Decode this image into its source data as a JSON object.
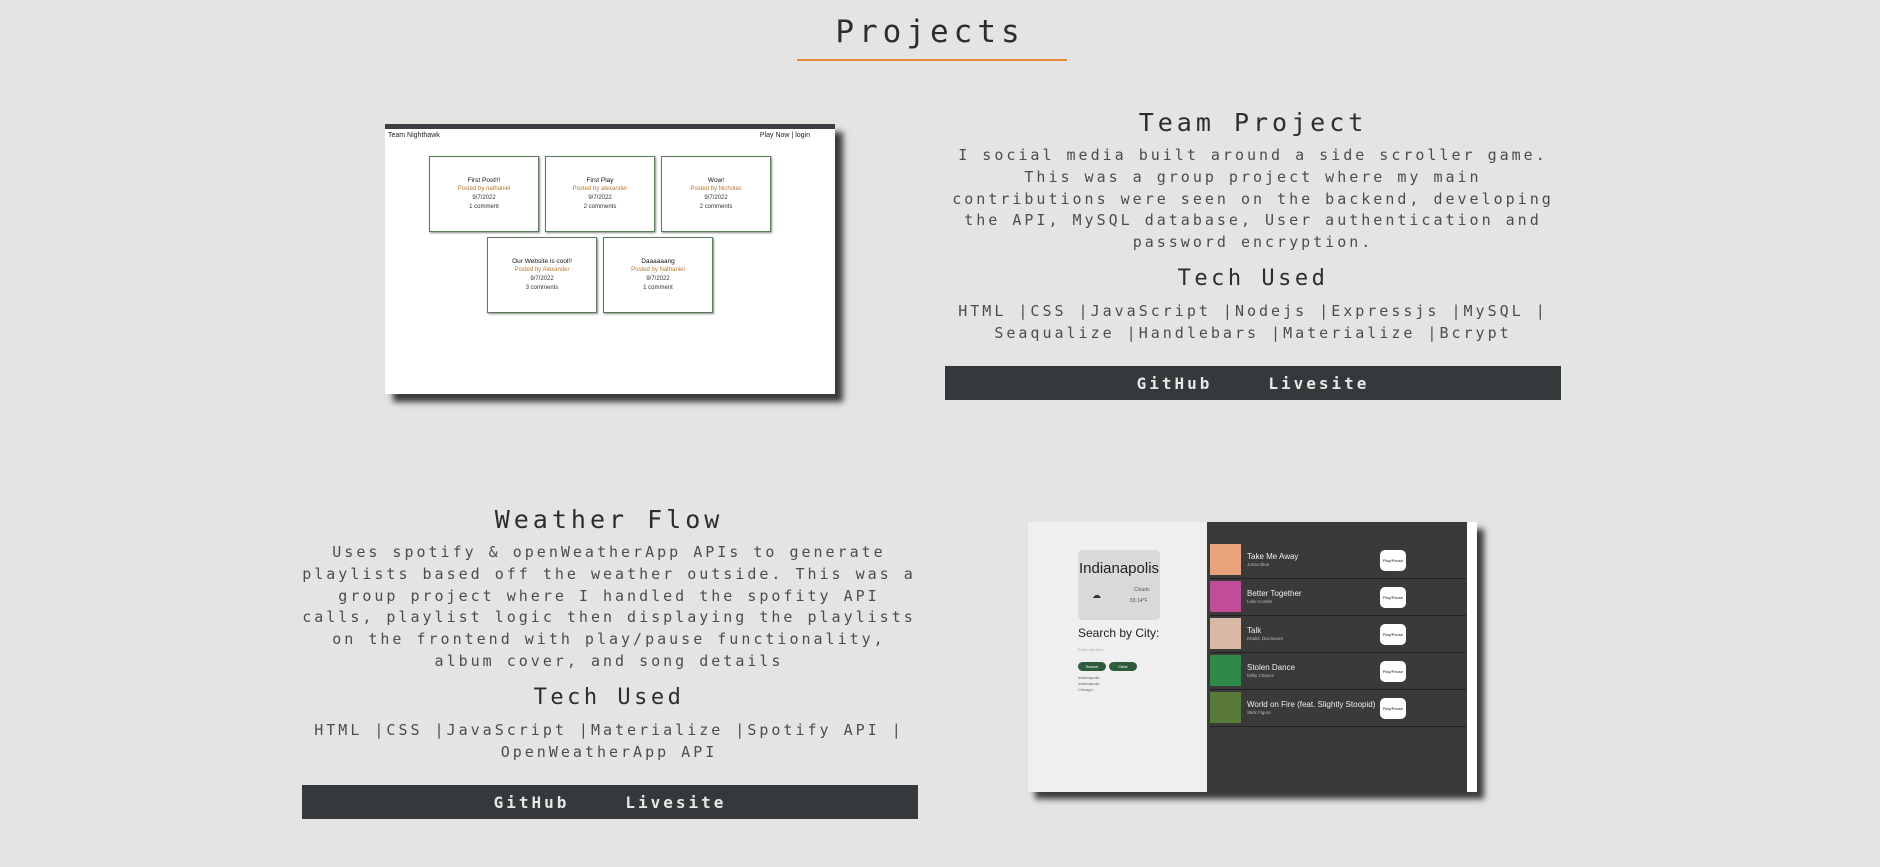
{
  "page": {
    "title": "Projects",
    "accent": "#e38b3a"
  },
  "projects": [
    {
      "name": "Team Project",
      "description": "I social media built around a side scroller game. This was a group project where my main contributions were seen on the backend, developing the API, MySQL database, User authentication and password encryption.",
      "tech_heading": "Tech Used",
      "tech": "HTML |CSS |JavaScript |Nodejs |Expressjs |MySQL | Seaqualize |Handlebars |Materialize |Bcrypt",
      "github_label": "GitHub",
      "livesite_label": "Livesite",
      "screenshot": {
        "brand": "Team Nighthawk",
        "nav_right": "Play Now |  login",
        "posts": [
          {
            "title": "First Post!!!",
            "byline": "Posted by nathaniel",
            "date": "9/7/2022",
            "comments": "1 comment"
          },
          {
            "title": "First Play",
            "byline": "Posted by alexander",
            "date": "9/7/2022",
            "comments": "2 comments"
          },
          {
            "title": "Wow!",
            "byline": "Posted by Nicholas",
            "date": "9/7/2022",
            "comments": "2 comments"
          },
          {
            "title": "Our Website is cool!!",
            "byline": "Posted by Alexander",
            "date": "9/7/2022",
            "comments": "3 comments"
          },
          {
            "title": "Daaaaaang",
            "byline": "Posted by Nathaniel",
            "date": "9/7/2022",
            "comments": "1 comment"
          }
        ]
      }
    },
    {
      "name": "Weather Flow",
      "description": "Uses spotify & openWeatherApp APIs to generate playlists based off the weather outside. This was a group project where I handled the spofity API calls, playlist logic then displaying the playlists on the frontend with play/pause functionality, album cover, and song details",
      "tech_heading": "Tech Used",
      "tech": "HTML |CSS |JavaScript |Materialize |Spotify API | OpenWeatherApp API",
      "github_label": "GitHub",
      "livesite_label": "Livesite",
      "screenshot": {
        "city": "Indianapolis",
        "condition": "Clouds",
        "temp": "83.14°F",
        "search_label": "Search by City:",
        "search_placeholder": "Enter city here",
        "btn_search": "Search",
        "btn_clear": "Clear",
        "history": [
          "Indianapolis",
          "Indianapolis",
          "Chicago"
        ],
        "play_label": "Play/Pause",
        "songs": [
          {
            "title": "Take Me Away",
            "artist": "Jonas Blue",
            "color": "#e8a37a"
          },
          {
            "title": "Better Together",
            "artist": "Luke Combs",
            "color": "#c44d9a"
          },
          {
            "title": "Talk",
            "artist": "Khalid, Disclosure",
            "color": "#d9b8a8"
          },
          {
            "title": "Stolen Dance",
            "artist": "Milky Chance",
            "color": "#2f8a4a"
          },
          {
            "title": "World on Fire (feat. Slightly Stoopid)",
            "artist": "Stick Figure",
            "color": "#5a7a3a"
          }
        ]
      }
    }
  ]
}
